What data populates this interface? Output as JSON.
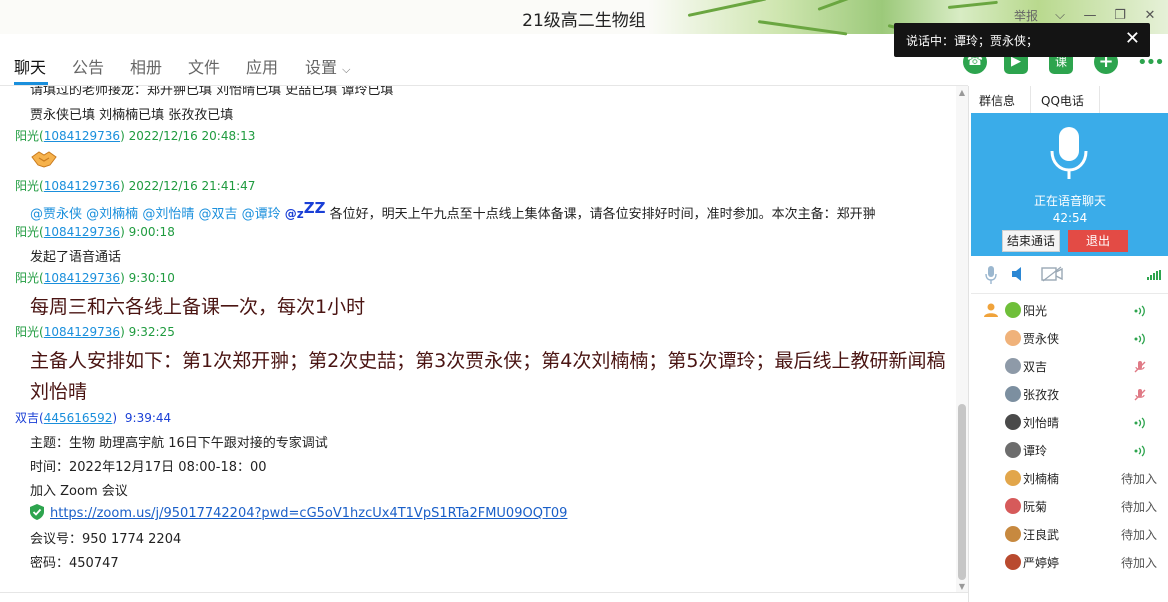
{
  "window": {
    "title": "21级高二生物组",
    "report_label": "举报"
  },
  "toast": {
    "text": "说话中：谭玲；贾永侠；"
  },
  "tabs": [
    {
      "label": "聊天"
    },
    {
      "label": "公告"
    },
    {
      "label": "相册"
    },
    {
      "label": "文件"
    },
    {
      "label": "应用"
    },
    {
      "label": "设置"
    }
  ],
  "actions": {
    "call_icon": "phone-icon",
    "video_icon": "video-call-icon",
    "class_label": "课",
    "add_icon": "plus-icon",
    "more_icon": "more-icon"
  },
  "chat": {
    "line_top_partial": "请填过的老师接龙：郑开翀已填   刘怡晴已填   史喆已填 谭玲已填",
    "line_fill2": "贾永侠已填    刘楠楠已填    张孜孜已填",
    "messages": [
      {
        "sender": "阳光",
        "qq": "1084129736",
        "time": "2022/12/16 20:48:13"
      },
      {
        "sender": "阳光",
        "qq": "1084129736",
        "time": "2022/12/16 21:41:47"
      },
      {
        "sender": "阳光",
        "qq": "1084129736",
        "time": "9:00:18"
      },
      {
        "sender": "阳光",
        "qq": "1084129736",
        "time": "9:30:10"
      },
      {
        "sender": "阳光",
        "qq": "1084129736",
        "time": "9:32:25"
      },
      {
        "sender": "双吉",
        "qq": "445616592",
        "time": "9:39:44"
      }
    ],
    "mentions": [
      "@贾永侠",
      "@刘楠楠",
      "@刘怡晴",
      "@双吉",
      "@谭玲"
    ],
    "at_sign": "@",
    "zz_text": "z",
    "zz_sup": "ZZ",
    "notice_text": "各位好，明天上午九点至十点线上集体备课，请各位安排好时间，准时参加。本次主备：郑开翀",
    "voice_call_text": "发起了语音通话",
    "big_text_1": "每周三和六各线上备课一次，每次1小时",
    "big_text_2a": "主备人安排如下：第1次郑开翀；第2次史喆；第3次贾永侠；第4次刘楠楠；第5次谭玲；最后线上教研新闻稿",
    "big_text_2b": "刘怡晴",
    "zoom": {
      "topic": "主题：生物 助理高宇航 16日下午跟对接的专家调试",
      "time": "时间：2022年12月17日  08:00-18：00",
      "join": "加入 Zoom 会议",
      "url": "https://zoom.us/j/95017742204?pwd=cG5oV1hzcUx4T1VpS1RTa2FMU09OQT09",
      "meeting_id": "会议号：950 1774 2204",
      "password": "密码：450747"
    }
  },
  "right_panel": {
    "tab_info": "群信息",
    "tab_call": "QQ电话",
    "call_status": "正在语音聊天",
    "call_time": "42:54",
    "end_call": "结束通话",
    "exit": "退出",
    "members": [
      {
        "name": "阳光",
        "state": "speaking"
      },
      {
        "name": "贾永侠",
        "state": "speaking"
      },
      {
        "name": "双吉",
        "state": "muted"
      },
      {
        "name": "张孜孜",
        "state": "muted"
      },
      {
        "name": "刘怡晴",
        "state": "speaking"
      },
      {
        "name": "谭玲",
        "state": "speaking"
      },
      {
        "name": "刘楠楠",
        "state": "待加入"
      },
      {
        "name": "阮菊",
        "state": "待加入"
      },
      {
        "name": "汪良武",
        "state": "待加入"
      },
      {
        "name": "严婷婷",
        "state": "待加入"
      }
    ]
  },
  "colors": {
    "sender_green": "#1f9b3f",
    "sender_blue": "#1a3fd6",
    "link": "#1a8fdc",
    "call_bg": "#3aace9",
    "exit_red": "#e34b45",
    "big_text": "#4a1412"
  }
}
